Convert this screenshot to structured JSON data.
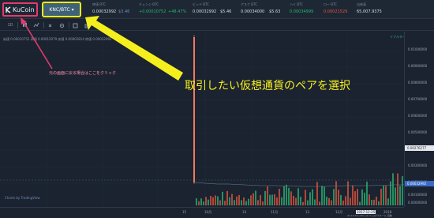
{
  "header": {
    "logo_text": "KuCoin",
    "pair_label": "KNC/BTC ▾",
    "tickers": [
      {
        "key": "終値 BTC",
        "value": "0.00032992",
        "extra": "$3.46"
      },
      {
        "key": "チェンジ BTC",
        "value": "+0.00010752",
        "extra": "+48.47%"
      },
      {
        "key": "ビッド BTC",
        "value": "0.00032992",
        "extra": "$5.46"
      },
      {
        "key": "アスク BTC",
        "value": "0.00034000",
        "extra": "$5.63"
      },
      {
        "key": "ハイ BTC",
        "value": "0.00034999",
        "extra": ""
      },
      {
        "key": "ロー BTC",
        "value": "0.00021529",
        "extra": ""
      },
      {
        "key": "出来高",
        "value": "65,007.9375",
        "extra": ""
      }
    ]
  },
  "toolbar": {
    "interval_label": "1D",
    "icons": [
      "candle-icon",
      "indicator-icon",
      "settings-icon",
      "fullscreen-icon",
      "camera-icon"
    ]
  },
  "chart": {
    "legend": "始値 0.00010752 高値 0.00012079 安値 0.00002814 終値 0.00032992",
    "series_label": "リアルタイム",
    "credit": "Charts by TradingView",
    "current_price_label": "0.00032992",
    "mid_price_label": "0.00276277",
    "price_labels": [
      "0.01000000",
      "0.00900000",
      "0.00800000",
      "0.00700000",
      "0.00600000",
      "0.00500000",
      "0.00400000",
      "0.00300000",
      "0.00200000",
      "0.00100000",
      "0.00000000"
    ],
    "time_labels": [
      "15",
      "10月",
      "14",
      "11月",
      "13",
      "12月",
      "2017-12-25",
      "2018"
    ],
    "footer_right": "21:15:34 (UTC+9)   %   ログスケール   自動",
    "colors": {
      "up": "#29b573",
      "down": "#e2553f",
      "spike": "#ef7b5b"
    }
  },
  "annotations": {
    "back_hint": "元の画面に戻る場合はここをクリック",
    "select_hint": "取引したい仮想通貨のペアを選択",
    "back_color": "#e23b6d",
    "select_color": "#f5ef1e"
  }
}
